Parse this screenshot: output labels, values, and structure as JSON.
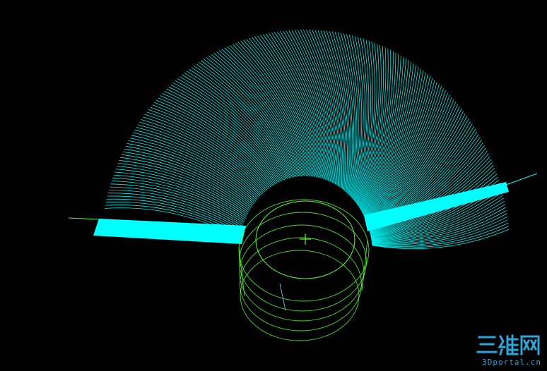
{
  "viewport": {
    "background": "#000000"
  },
  "colors": {
    "wireframe": "#00ffff",
    "construction": "#55ff33",
    "watermark": "#2aa7d8"
  },
  "scene": {
    "fan_lines": 200,
    "base_rings": 5,
    "origin_marker": "crosshair-icon"
  },
  "watermark": {
    "logo_text": "三维网",
    "site_text": "3Dportal.cn"
  }
}
